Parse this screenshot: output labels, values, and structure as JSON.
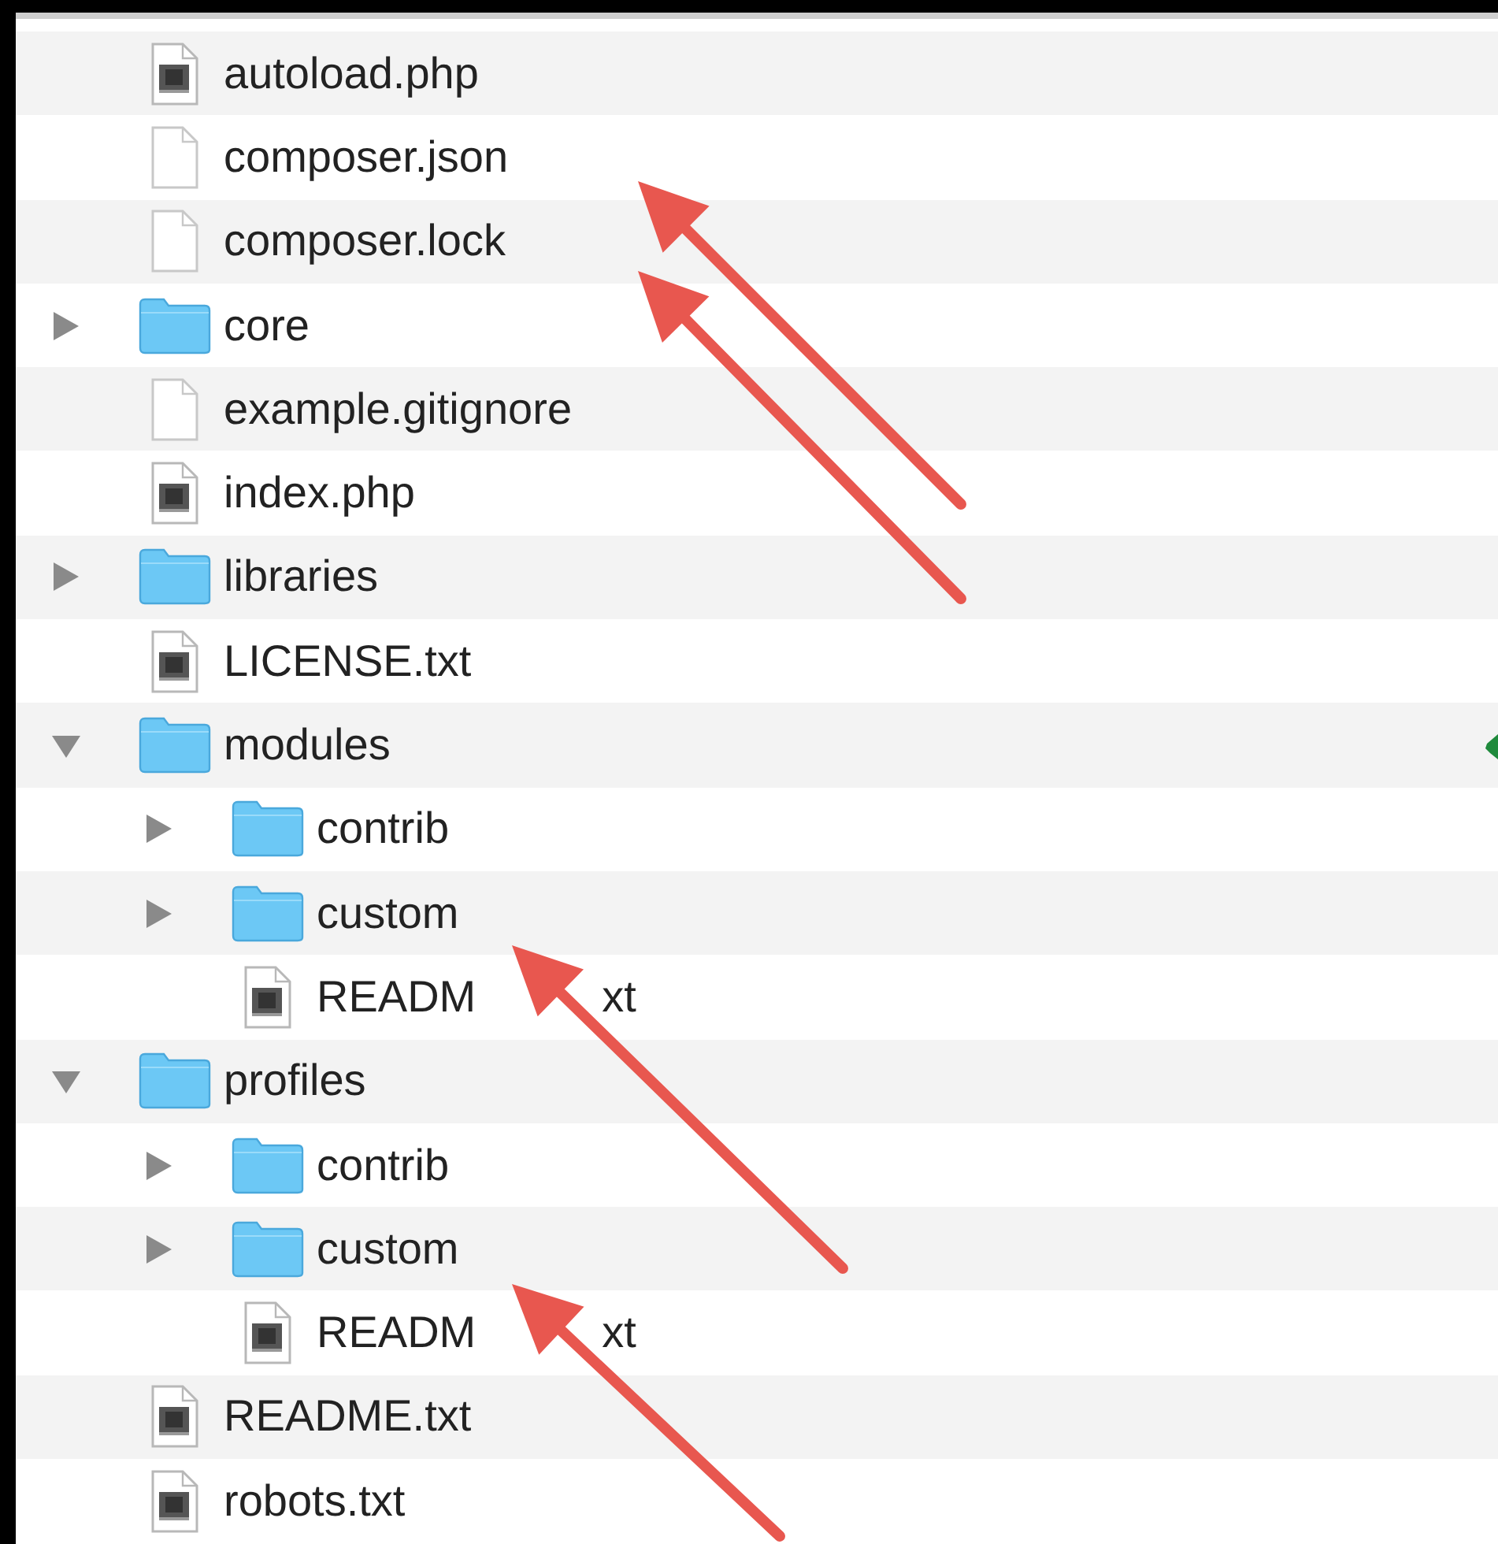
{
  "files": [
    {
      "name": "autoload.php",
      "kind": "script"
    },
    {
      "name": "composer.json",
      "kind": "document"
    },
    {
      "name": "composer.lock",
      "kind": "document"
    },
    {
      "name": "core",
      "kind": "folder",
      "expanded": false
    },
    {
      "name": "example.gitignore",
      "kind": "document"
    },
    {
      "name": "index.php",
      "kind": "script"
    },
    {
      "name": "libraries",
      "kind": "folder",
      "expanded": false
    },
    {
      "name": "LICENSE.txt",
      "kind": "script"
    },
    {
      "name": "modules",
      "kind": "folder",
      "expanded": true,
      "children": [
        {
          "name": "contrib",
          "kind": "folder",
          "expanded": false
        },
        {
          "name": "custom",
          "kind": "folder",
          "expanded": false
        },
        {
          "name": "READM",
          "covered_tail": "xt",
          "kind": "script"
        }
      ]
    },
    {
      "name": "profiles",
      "kind": "folder",
      "expanded": true,
      "children": [
        {
          "name": "contrib",
          "kind": "folder",
          "expanded": false
        },
        {
          "name": "custom",
          "kind": "folder",
          "expanded": false
        },
        {
          "name": "READM",
          "covered_tail": "xt",
          "kind": "script"
        }
      ]
    },
    {
      "name": "README.txt",
      "kind": "script"
    },
    {
      "name": "robots.txt",
      "kind": "script"
    }
  ]
}
